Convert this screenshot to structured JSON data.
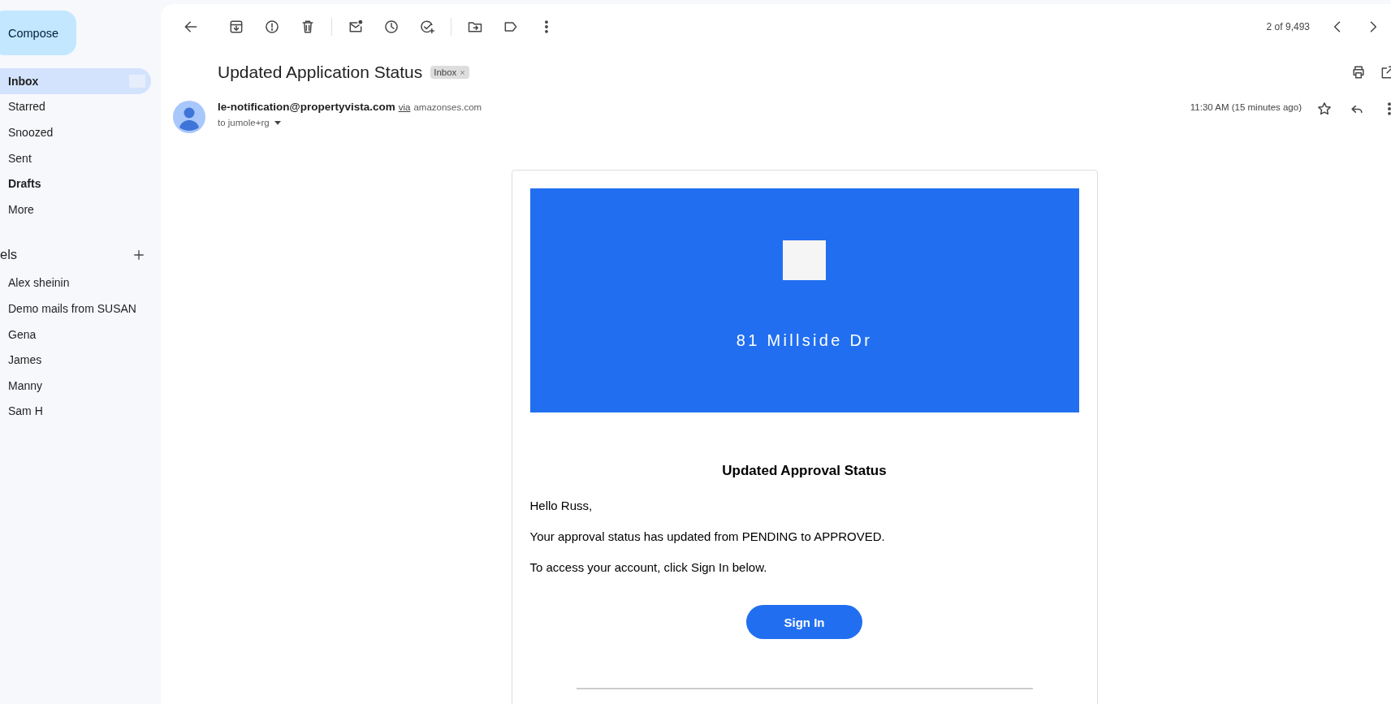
{
  "sidebar": {
    "compose_button": "Compose",
    "nav_items": [
      {
        "label": "Inbox",
        "selected": true,
        "unread": true
      },
      {
        "label": "Starred",
        "selected": false,
        "unread": false
      },
      {
        "label": "Snoozed",
        "selected": false,
        "unread": false
      },
      {
        "label": "Sent",
        "selected": false,
        "unread": false
      },
      {
        "label": "Drafts",
        "selected": false,
        "unread": true
      },
      {
        "label": "More",
        "selected": false,
        "unread": false
      }
    ],
    "labels_heading": "els",
    "labels": [
      {
        "label": "Alex sheinin"
      },
      {
        "label": "Demo mails from SUSAN"
      },
      {
        "label": "Gena"
      },
      {
        "label": "James"
      },
      {
        "label": "Manny"
      },
      {
        "label": "Sam H"
      }
    ]
  },
  "toolbar": {
    "counter": "2 of 9,493"
  },
  "message": {
    "subject": "Updated Application Status",
    "tag": "Inbox",
    "sender": "le-notification@propertyvista.com",
    "via": "via",
    "relay": "amazonses.com",
    "recipient": "to jumole+rg",
    "time": "11:30 AM (15 minutes ago)",
    "body": {
      "banner_title": "81 Millside Dr",
      "heading": "Updated Approval Status",
      "paragraphs": [
        "Hello Russ,",
        "Your approval status has updated from PENDING to APPROVED.",
        "To access your account, click Sign In below."
      ],
      "button": "Sign In"
    }
  }
}
